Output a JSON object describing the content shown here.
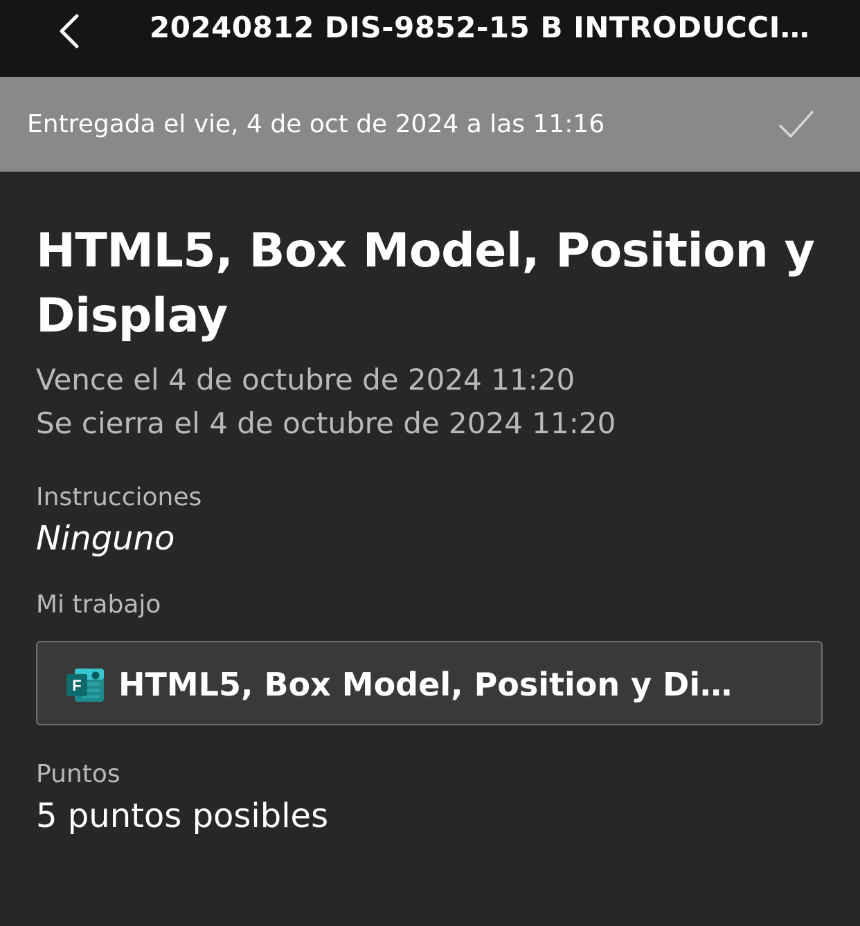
{
  "topbar": {
    "back_icon": "chevron-left-icon",
    "title": "20240812 DIS-9852-15 B  INTRODUCCIO..."
  },
  "banner": {
    "text": "Entregada el vie, 4 de oct de 2024 a las 11:16",
    "status_icon": "checkmark-icon",
    "background_color": "#898989"
  },
  "assignment": {
    "title": "HTML5, Box Model, Position y Display",
    "due": "Vence el 4 de octubre de 2024 11:20",
    "closes": "Se cierra el 4 de octubre de 2024 11:20"
  },
  "instructions": {
    "label": "Instrucciones",
    "value": "Ninguno"
  },
  "my_work": {
    "label": "Mi trabajo",
    "attachment": {
      "icon": "microsoft-forms-icon",
      "icon_letter": "F",
      "name": "HTML5, Box Model, Position y Displ..."
    }
  },
  "points": {
    "label": "Puntos",
    "value": "5 puntos posibles"
  },
  "colors": {
    "background": "#272727",
    "topbar": "#151515",
    "forms_brand": "#1f8a8c"
  }
}
